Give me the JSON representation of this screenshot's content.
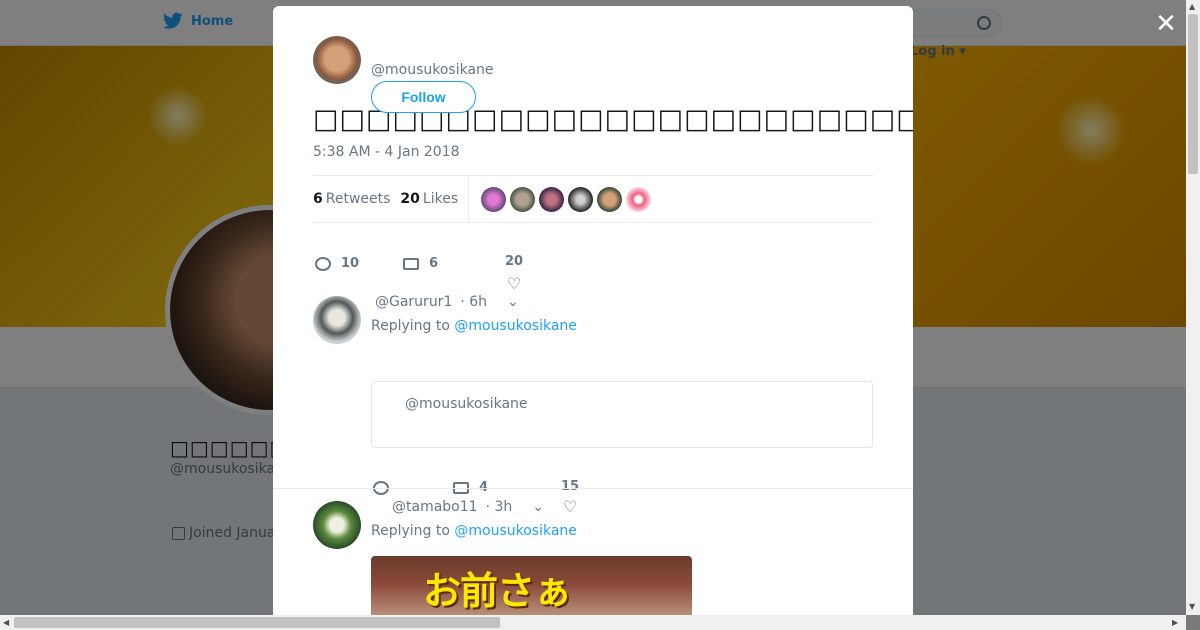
{
  "background": {
    "home_label": "Home",
    "profile_name": "□□□□□□□□□□",
    "profile_handle": "@mousukosika",
    "joined": "Joined Janua",
    "login_label": "Log in"
  },
  "tweet": {
    "handle": "@mousukosikane",
    "follow_label": "Follow",
    "text": "□□□□□□□□□□□□□□□□□□□□□□□□□□□□□□□□□□□□□□□□□□□□□□□□□□□□□□□□□□□□□□□□□□□□□□□□□□",
    "timestamp": "5:38 AM - 4 Jan 2018",
    "retweets_count": "6",
    "retweets_label": "Retweets",
    "likes_count": "20",
    "likes_label": "Likes",
    "reply_count": "10",
    "rt_count": "6",
    "like_count": "20"
  },
  "replies": [
    {
      "handle": "@Garurur1",
      "time": "· 6h",
      "replying_prefix": "Replying to",
      "replying_to": "@mousukosikane",
      "quote_handle": "@mousukosikane",
      "reply_count": "",
      "rt_count": "4",
      "like_count": "15"
    },
    {
      "handle": "@tamabo11",
      "time": "· 3h",
      "replying_prefix": "Replying to",
      "replying_to": "@mousukosikane",
      "media_text": "お前さぁ"
    }
  ],
  "colors": {
    "accent": "#1da1f2",
    "muted": "#657786",
    "text": "#14171a"
  }
}
